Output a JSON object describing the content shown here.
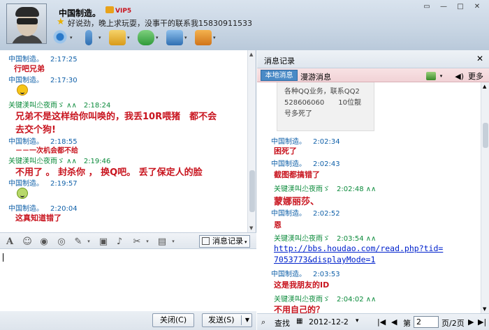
{
  "header": {
    "contact_name": "中国制造。",
    "vip_label": "VIP5",
    "signature": "好说劲，晚上求玩耍，没事干的联系我15830911533",
    "toolbar_icons": [
      "video-icon",
      "microphone-icon",
      "file-transfer-icon",
      "message-icon",
      "remote-desktop-icon",
      "app-icon"
    ]
  },
  "chat": {
    "messages": [
      {
        "sender": "中国制造。",
        "time": "2:17:25",
        "text": "行吧兄弟",
        "color": "blue"
      },
      {
        "sender": "中国制造。",
        "time": "2:17:30",
        "emoji": "laugh-emoji",
        "color": "blue"
      },
      {
        "sender": "关键渼叫尐夜雨ゞ",
        "time": "2:18:24",
        "text_line1": "兄弟不是这样给你叫唤的，我丢10R喂猪　都不会",
        "text_line2": "去交个狗!",
        "color": "green"
      },
      {
        "sender": "中国制造。",
        "time": "2:18:55",
        "text": "－－一次机会都不给",
        "color": "blue"
      },
      {
        "sender": "关键渼叫尐夜雨ゞ",
        "time": "2:19:46",
        "text": "不用了 。  封杀你 ，  换Q吧。  丢了保定人的脸",
        "color": "green"
      },
      {
        "sender": "中国制造。",
        "time": "2:19:57",
        "emoji": "cry-emoji",
        "color": "blue"
      },
      {
        "sender": "中国制造。",
        "time": "2:20:04",
        "text": "这真知道错了",
        "color": "blue"
      }
    ]
  },
  "input_toolbar": {
    "history_button": "消息记录"
  },
  "buttons": {
    "close": "关闭(C)",
    "send": "发送(S)"
  },
  "history": {
    "title": "消息记录",
    "tab_local": "本地消息",
    "tab_roaming": "漫游消息",
    "more": "更多",
    "ad_text": [
      "各种QQ业务，联系QQ2",
      "528606060　　10位靓",
      "号多死了"
    ],
    "messages": [
      {
        "sender": "中国制造。",
        "time": "2:02:34",
        "text": "困死了"
      },
      {
        "sender": "中国制造。",
        "time": "2:02:43",
        "text": "截图都搞错了"
      },
      {
        "sender": "关键渼叫尐夜雨ゞ",
        "time": "2:02:48",
        "text": "蒙娜丽莎、"
      },
      {
        "sender": "中国制造。",
        "time": "2:02:52",
        "text": "恩"
      },
      {
        "sender": "关键渼叫尐夜雨ゞ",
        "time": "2:03:54",
        "link": [
          "http://bbs.houdao.com/read.php?tid=",
          "7053773&displayMode=1"
        ]
      },
      {
        "sender": "中国制造。",
        "time": "2:03:53",
        "text": "这是我朋友的ID"
      },
      {
        "sender": "关键渼叫尐夜雨ゞ",
        "time": "2:04:02",
        "text": "不用自己的？"
      }
    ],
    "footer": {
      "search": "查找",
      "date": "2012-12-2",
      "page_label": "第",
      "page_value": "2",
      "page_total": "页/2页"
    }
  }
}
